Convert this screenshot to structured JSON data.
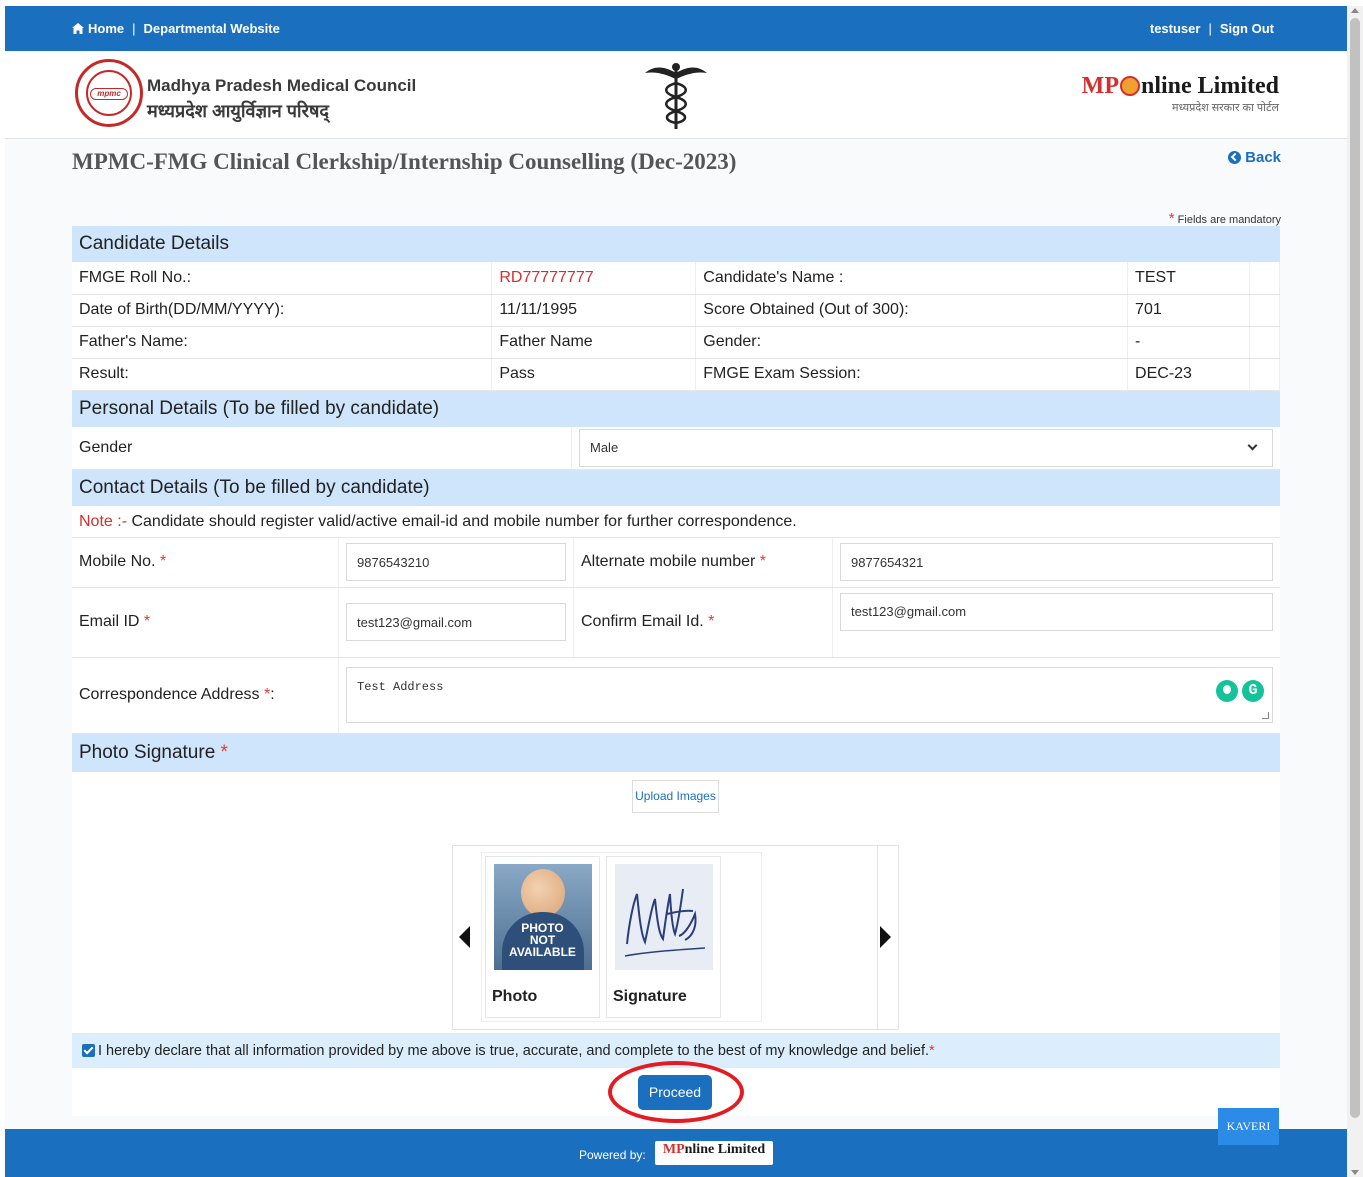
{
  "topbar": {
    "home": "Home",
    "separator": "|",
    "departmental": "Departmental Website",
    "user": "testuser",
    "signout": "Sign Out"
  },
  "header": {
    "council_en": "Madhya Pradesh Medical Council",
    "council_hi": "मध्यप्रदेश आयुर्विज्ञान परिषद्",
    "logo_tag": "mpmc",
    "partner_mp": "MP",
    "partner_rest": "nline Limited",
    "partner_sub": "मध्यप्रदेश सरकार का पोर्टल"
  },
  "page": {
    "title": "MPMC-FMG Clinical Clerkship/Internship Counselling (Dec-2023)",
    "back": "Back",
    "mandatory_star": "*",
    "mandatory_text": "Fields are mandatory"
  },
  "candidate": {
    "heading": "Candidate Details",
    "rows": [
      {
        "l1": "FMGE Roll No.:",
        "v1": "RD77777777",
        "l2": "Candidate's Name :",
        "v2": "TEST"
      },
      {
        "l1": "Date of Birth(DD/MM/YYYY):",
        "v1": "11/11/1995",
        "l2": "Score Obtained (Out of 300):",
        "v2": "701"
      },
      {
        "l1": "Father's Name:",
        "v1": "Father Name",
        "l2": "Gender:",
        "v2": "-"
      },
      {
        "l1": "Result:",
        "v1": "Pass",
        "l2": "FMGE Exam Session:",
        "v2": "DEC-23"
      }
    ]
  },
  "personal": {
    "heading": "Personal Details (To be filled by candidate)",
    "gender_label": "Gender",
    "gender_value": "Male"
  },
  "contact": {
    "heading": "Contact Details (To be filled by candidate)",
    "note_label": "Note :-",
    "note_text": "Candidate should register valid/active email-id and mobile number for further correspondence.",
    "mobile_label": "Mobile No.",
    "mobile_value": "9876543210",
    "alt_mobile_label": "Alternate mobile number",
    "alt_mobile_value": "9877654321",
    "email_label": "Email ID",
    "email_value": "test123@gmail.com",
    "confirm_email_label": "Confirm Email Id.",
    "confirm_email_value": "test123@gmail.com",
    "address_label": "Correspondence Address",
    "address_suffix": ":",
    "address_value": "Test Address",
    "grammarly_letter": "G"
  },
  "photo": {
    "heading": "Photo Signature",
    "upload": "Upload Images",
    "photo_caption": "Photo",
    "signature_caption": "Signature",
    "photo_placeholder_1": "PHOTO",
    "photo_placeholder_2": "NOT",
    "photo_placeholder_3": "AVAILABLE"
  },
  "declaration": {
    "text": "I hereby declare that all information provided by me above is true, accurate, and complete to the best of my knowledge and belief.",
    "checked": true
  },
  "actions": {
    "proceed": "Proceed",
    "kaveri": "KAVERI"
  },
  "footer": {
    "powered": "Powered by:",
    "logo_mp": "MP",
    "logo_rest": "nline Limited"
  },
  "colors": {
    "primary": "#1b6fbf",
    "section_bg": "#cfe5fb",
    "required": "#e53935",
    "highlight_ring": "#e31b23"
  }
}
